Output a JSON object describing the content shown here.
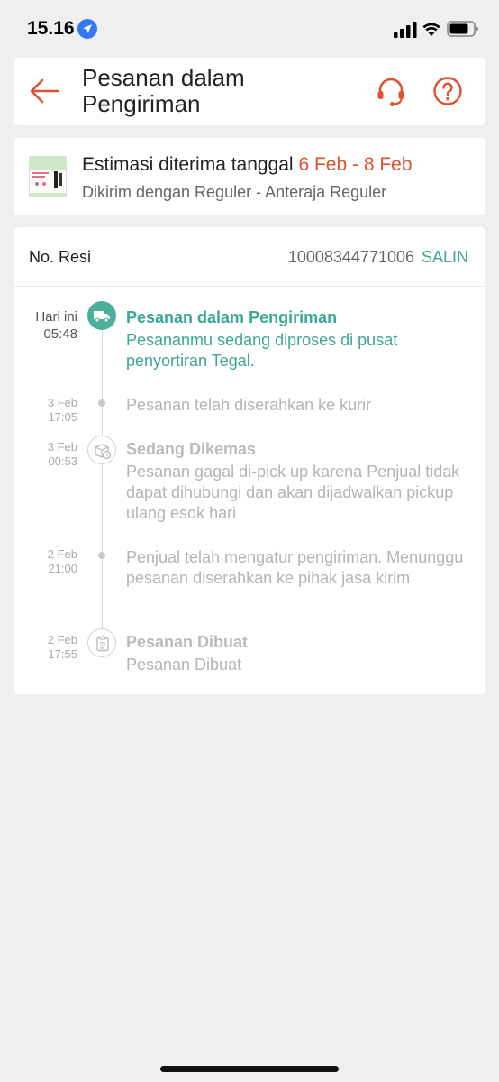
{
  "status_bar": {
    "time": "15.16",
    "icons": [
      "location-arrow-icon",
      "signal-icon",
      "wifi-icon",
      "battery-icon"
    ]
  },
  "header": {
    "title": "Pesanan dalam Pengiriman",
    "icons": [
      "back-arrow-icon",
      "headset-icon",
      "help-icon"
    ]
  },
  "estimate": {
    "label": "Estimasi diterima tanggal",
    "date_range": "6 Feb - 8 Feb",
    "shipping": "Dikirim dengan Reguler - Anteraja Reguler"
  },
  "tracking": {
    "resi_label": "No. Resi",
    "resi_number": "10008344771006",
    "copy_label": "SALIN",
    "events": [
      {
        "date": "Hari ini",
        "time": "05:48",
        "title": "Pesanan dalam Pengiriman",
        "description": "Pesananmu sedang diproses di pusat penyortiran Tegal.",
        "icon": "truck-icon",
        "active": true
      },
      {
        "date": "3 Feb",
        "time": "17:05",
        "title": "",
        "description": "Pesanan telah diserahkan ke kurir",
        "icon": "dot",
        "active": false
      },
      {
        "date": "3 Feb",
        "time": "00:53",
        "title": "Sedang Dikemas",
        "description": "Pesanan gagal di-pick up karena Penjual tidak dapat dihubungi dan akan dijadwalkan pickup ulang esok hari",
        "icon": "package-clock-icon",
        "active": false
      },
      {
        "date": "2 Feb",
        "time": "21:00",
        "title": "",
        "description": "Penjual telah mengatur pengiriman. Menunggu pesanan diserahkan ke pihak jasa kirim",
        "icon": "dot",
        "active": false
      },
      {
        "date": "2 Feb",
        "time": "17:55",
        "title": "Pesanan Dibuat",
        "description": "Pesanan Dibuat",
        "icon": "clipboard-icon",
        "active": false
      }
    ]
  },
  "colors": {
    "accent_orange": "#e0502f",
    "accent_teal": "#3aa892",
    "background": "#efeff0"
  }
}
